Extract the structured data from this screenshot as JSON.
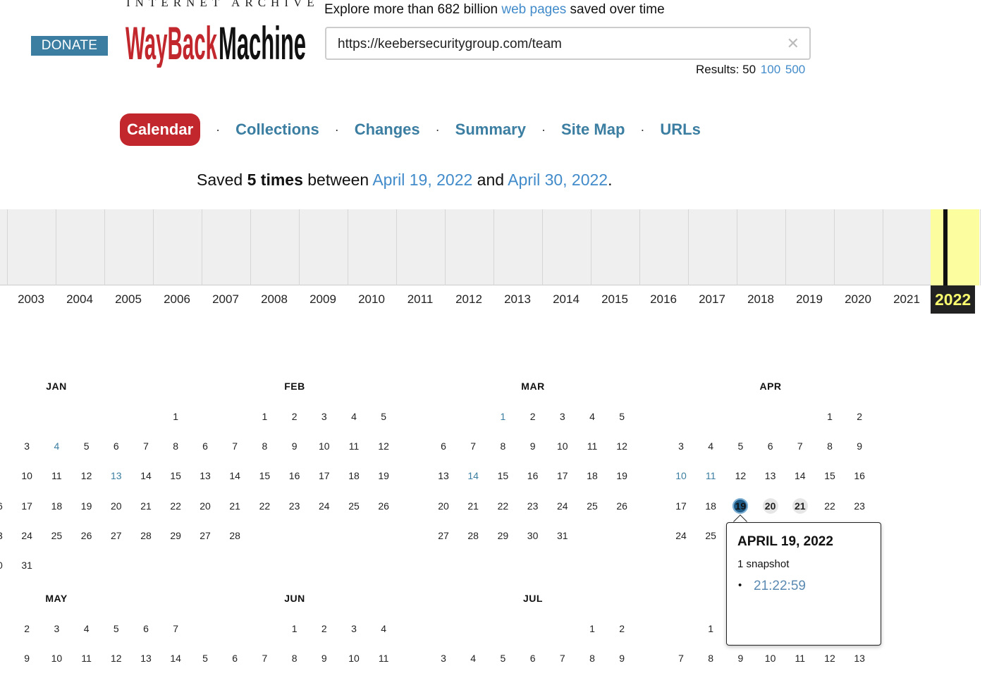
{
  "header": {
    "donate_label": "DONATE",
    "logo_top": "INTERNET ARCHIVE",
    "logo_main": "WayBackMachine",
    "explore_prefix": "Explore more than 682 billion ",
    "explore_link": "web pages",
    "explore_suffix": " saved over time",
    "url_value": "https://keebersecuritygroup.com/team",
    "clear_icon": "close-icon",
    "results_label": "Results: 50",
    "results_100": "100",
    "results_500": "500"
  },
  "nav": {
    "calendar": "Calendar",
    "collections": "Collections",
    "changes": "Changes",
    "summary": "Summary",
    "sitemap": "Site Map",
    "urls": "URLs",
    "separator": "·"
  },
  "saved": {
    "prefix": "Saved ",
    "count": "5 times",
    "middle": " between ",
    "start": "April 19, 2022",
    "and": " and ",
    "end": "April 30, 2022",
    "period": "."
  },
  "timeline": {
    "years": [
      "2003",
      "2004",
      "2005",
      "2006",
      "2007",
      "2008",
      "2009",
      "2010",
      "2011",
      "2012",
      "2013",
      "2014",
      "2015",
      "2016",
      "2017",
      "2018",
      "2019",
      "2020",
      "2021"
    ],
    "current_year": "2022"
  },
  "calendar": {
    "months": {
      "jan": "JAN",
      "feb": "FEB",
      "mar": "MAR",
      "apr": "APR",
      "may": "MAY",
      "jun": "JUN",
      "jul": "JUL"
    },
    "snapshot_days": [
      "19",
      "20",
      "21"
    ]
  },
  "popup": {
    "date": "APRIL 19, 2022",
    "count": "1 snapshot",
    "bullet": "•",
    "time": "21:22:59"
  },
  "colors": {
    "accent": "#3b7ea1",
    "active_tab": "#c1272d",
    "link": "#428bca",
    "timeline_highlight": "#fbfd9e"
  }
}
